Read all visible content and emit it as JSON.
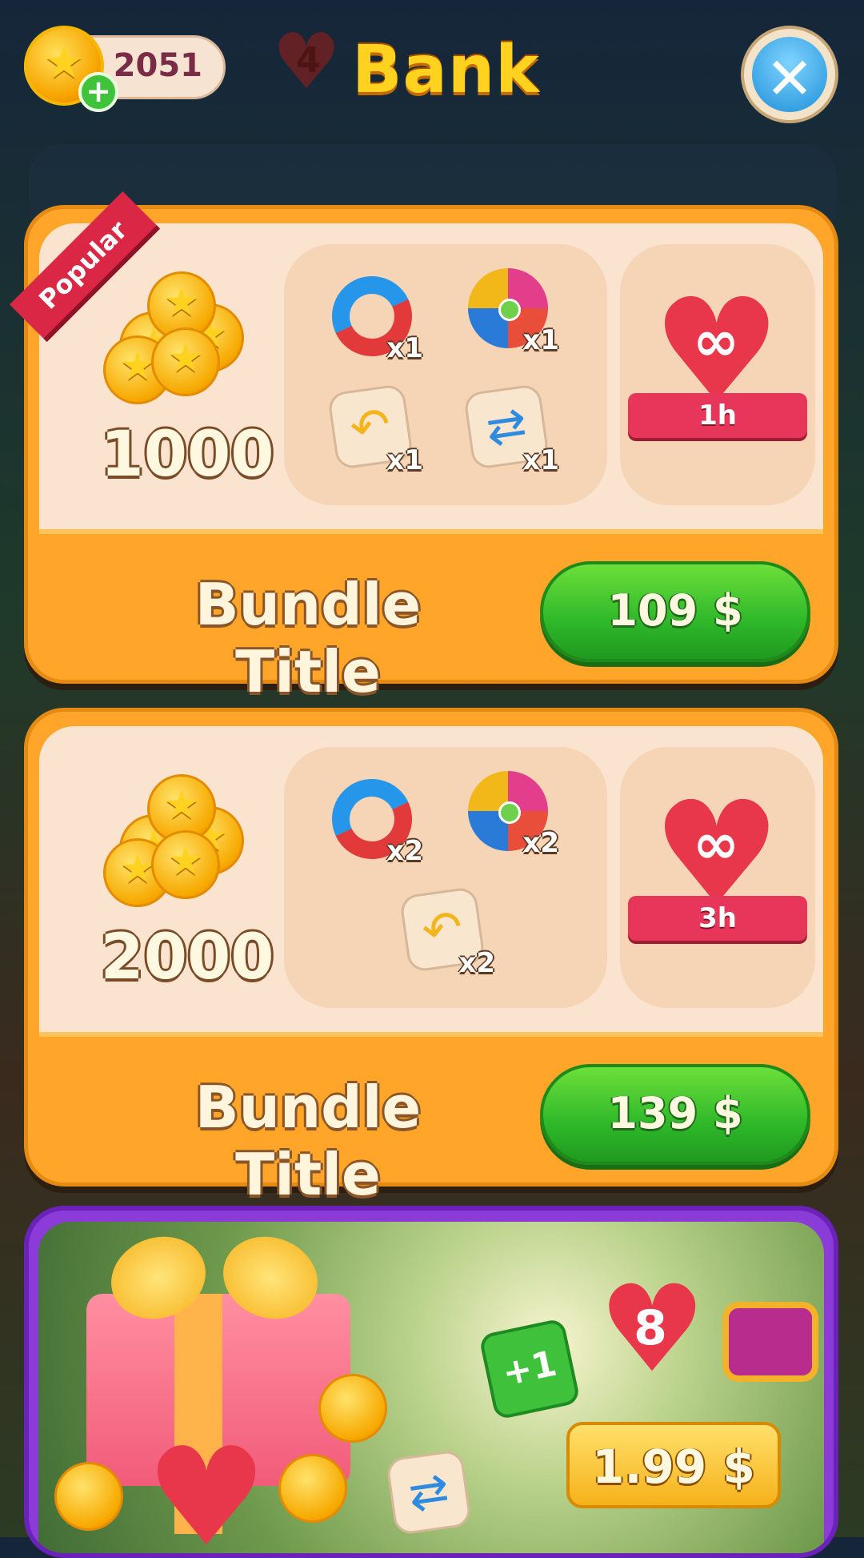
{
  "header": {
    "coin_count": "2051",
    "lives_count": "4",
    "title": "Bank",
    "plus_glyph": "+",
    "close_glyph": "✕"
  },
  "bundles": [
    {
      "ribbon": "Popular",
      "coins": "1000",
      "boosters": [
        {
          "icon": "magnet-icon",
          "qty": "x1"
        },
        {
          "icon": "pinwheel-icon",
          "qty": "x1"
        },
        {
          "icon": "undo-icon",
          "qty": "x1"
        },
        {
          "icon": "shuffle-icon",
          "qty": "x1"
        }
      ],
      "infinite_lives": "1h",
      "title": "Bundle Title",
      "price": "109 $"
    },
    {
      "coins": "2000",
      "boosters": [
        {
          "icon": "magnet-icon",
          "qty": "x2"
        },
        {
          "icon": "pinwheel-icon",
          "qty": "x2"
        },
        {
          "icon": "undo-icon",
          "qty": "x2"
        }
      ],
      "infinite_lives": "3h",
      "title": "Bundle Title",
      "price": "139 $"
    }
  ],
  "offer": {
    "plus_one": "+1",
    "hearts": "8",
    "price": "1.99 $"
  },
  "colors": {
    "card_orange": "#ffa52a",
    "buy_green": "#2fb82a",
    "title_yellow": "#ffd21f",
    "offer_purple": "#8a3bd8"
  }
}
